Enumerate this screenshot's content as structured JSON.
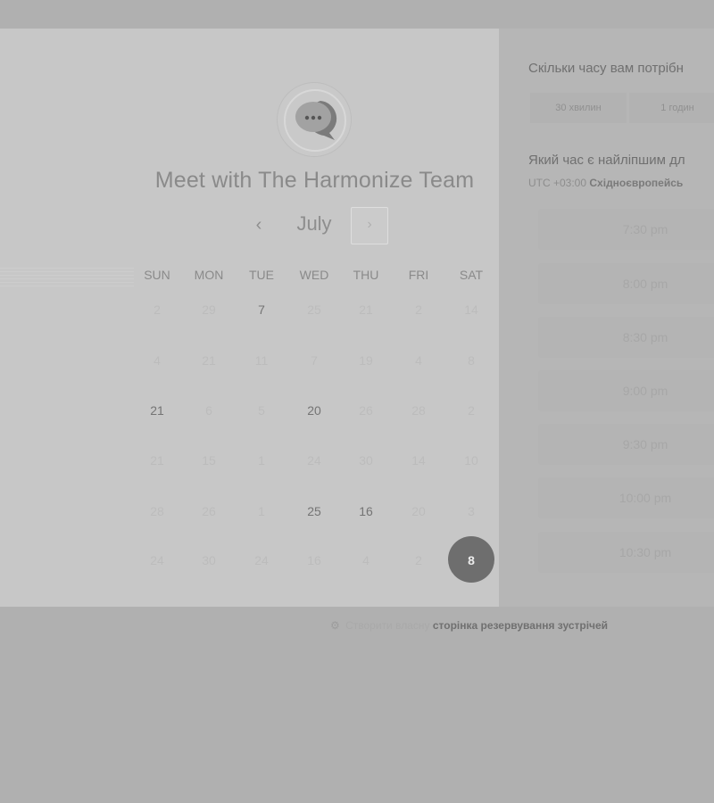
{
  "booking": {
    "title": "Meet with The Harmonize Team",
    "avatar_icon": "chat-bubble-ellipsis-icon",
    "month": "July",
    "prev_icon": "‹",
    "next_icon": "›",
    "weekdays": [
      "SUN",
      "MON",
      "TUE",
      "WED",
      "THU",
      "FRI",
      "SAT"
    ],
    "weeks": [
      [
        "2",
        "29",
        "7",
        "25",
        "21",
        "2",
        "14"
      ],
      [
        "4",
        "21",
        "11",
        "7",
        "19",
        "4",
        "8"
      ],
      [
        "21",
        "6",
        "5",
        "20",
        "26",
        "28",
        "2"
      ],
      [
        "21",
        "15",
        "1",
        "24",
        "30",
        "14",
        "10"
      ],
      [
        "28",
        "26",
        "1",
        "25",
        "16",
        "20",
        "3"
      ],
      [
        "24",
        "30",
        "24",
        "16",
        "4",
        "2",
        "8"
      ]
    ],
    "selected_day": "8",
    "accent_color": "#6e6e6e"
  },
  "scheduler": {
    "duration_question": "Скільки часу вам потрібн",
    "durations": [
      "30 хвилин",
      "1 годин"
    ],
    "time_question": "Який час є найліпшим дл",
    "timezone_prefix": "UTC +03:00",
    "timezone_name": "Східноєвропейсь",
    "slots": [
      "7:30 pm",
      "8:00 pm",
      "8:30 pm",
      "9:00 pm",
      "9:30 pm",
      "10:00 pm",
      "10:30 pm"
    ]
  },
  "footer": {
    "icon": "hubspot-sprocket-icon",
    "prefix": "Створити власну",
    "link": "сторінка резервування зустрічей"
  }
}
